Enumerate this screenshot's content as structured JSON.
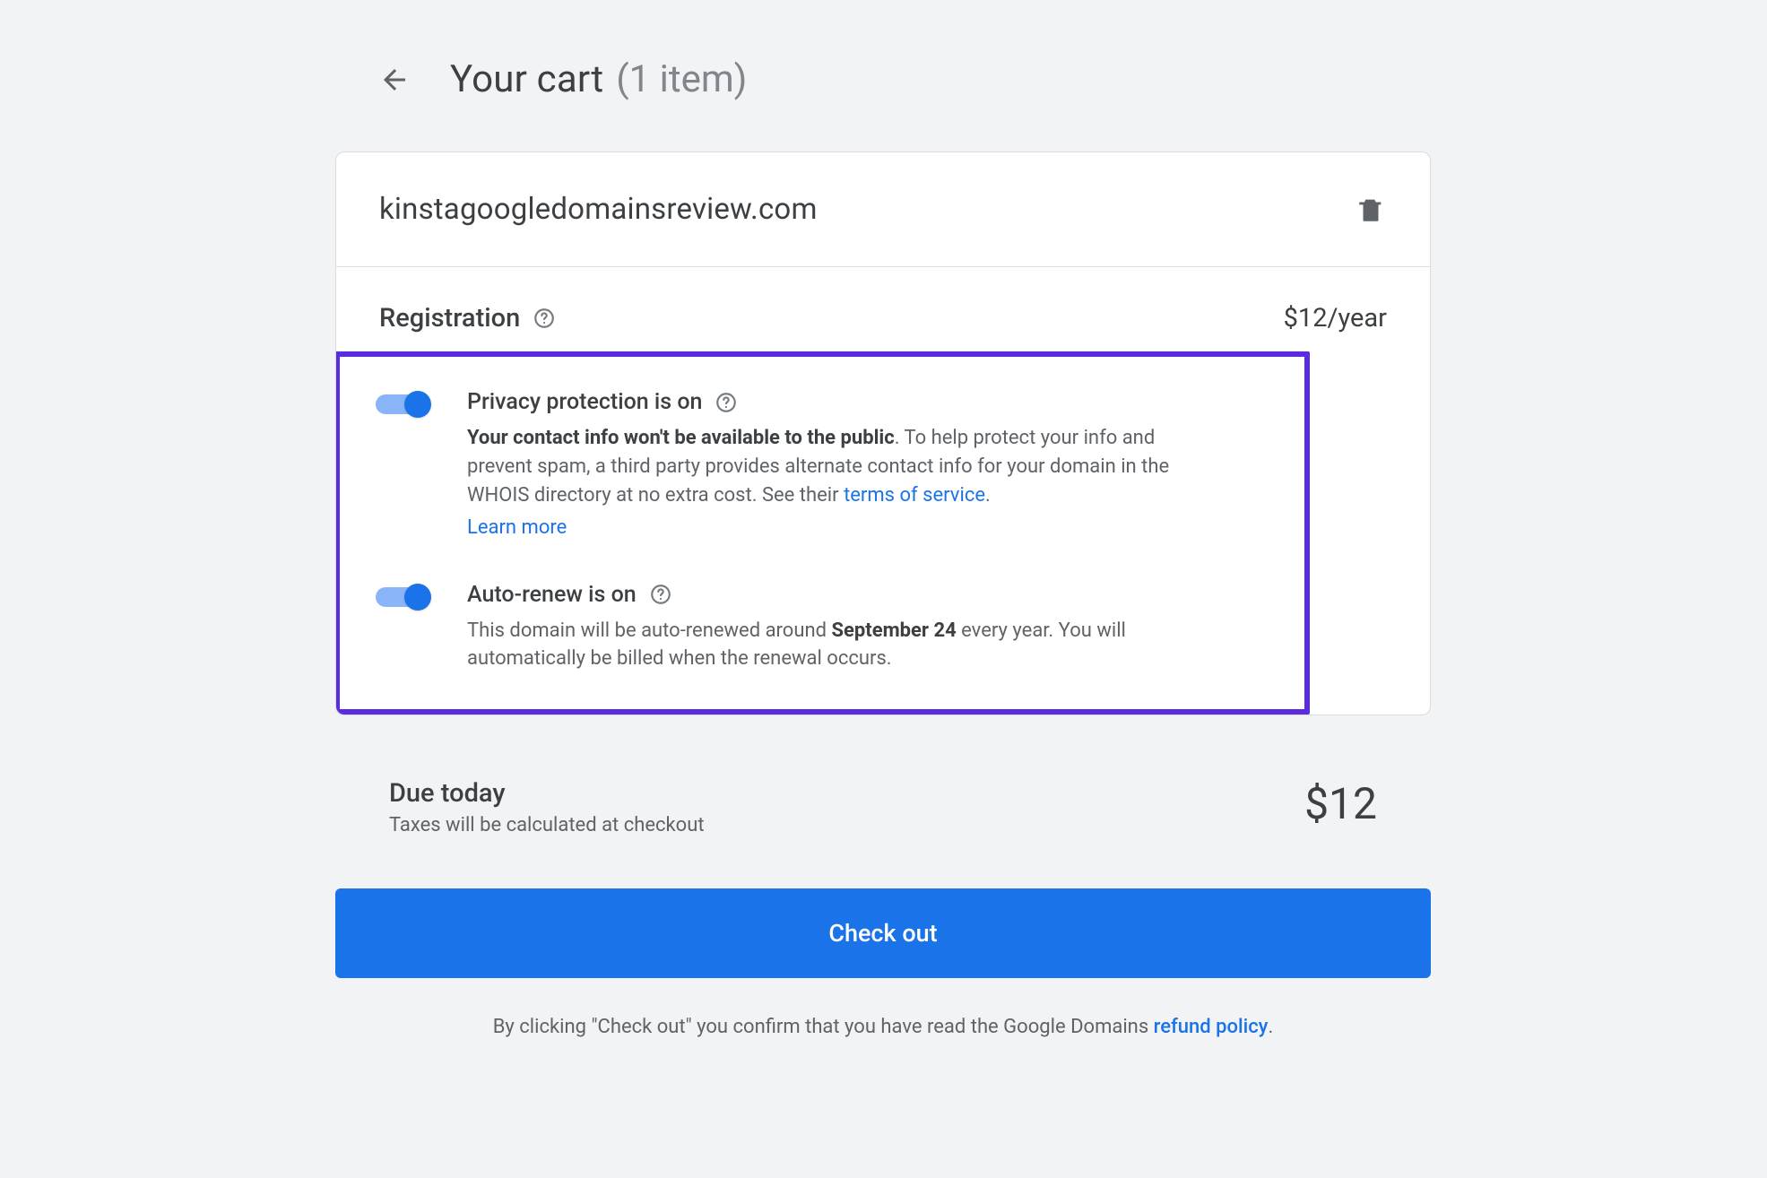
{
  "header": {
    "title": "Your cart",
    "count_text": "(1 item)"
  },
  "domain": {
    "name": "kinstagoogledomainsreview.com"
  },
  "registration": {
    "label": "Registration",
    "price": "$12/year"
  },
  "privacy": {
    "title": "Privacy protection is on",
    "desc_bold": "Your contact info won't be available to the public",
    "desc_rest": ". To help protect your info and prevent spam, a third party provides alternate contact info for your domain in the WHOIS directory at no extra cost. See their ",
    "tos_link": "terms of service",
    "learn_more": "Learn more"
  },
  "autorenew": {
    "title": "Auto-renew is on",
    "desc_pre": "This domain will be auto-renewed around ",
    "date": "September 24",
    "desc_post": " every year. You will automatically be billed when the renewal occurs."
  },
  "due": {
    "title": "Due today",
    "note": "Taxes will be calculated at checkout",
    "amount": "$12"
  },
  "checkout": {
    "label": "Check out"
  },
  "fineprint": {
    "pre": "By clicking \"Check out\" you confirm that you have read the Google Domains ",
    "link": "refund policy",
    "post": "."
  }
}
